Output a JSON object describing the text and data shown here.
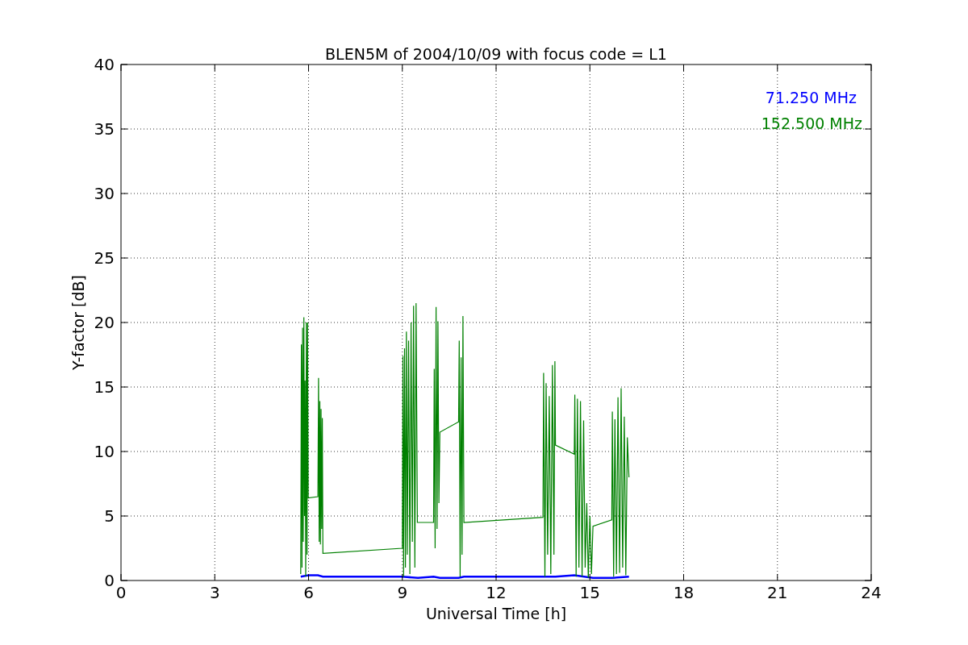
{
  "chart_data": {
    "type": "line",
    "grid": true,
    "title": "BLEN5M of 2004/10/09 with focus code = L1",
    "xlabel": "Universal Time [h]",
    "ylabel": "Y-factor [dB]",
    "xlim": [
      0,
      24
    ],
    "ylim": [
      0,
      40
    ],
    "xticks": [
      0,
      3,
      6,
      9,
      12,
      15,
      18,
      21,
      24
    ],
    "yticks": [
      0,
      5,
      10,
      15,
      20,
      25,
      30,
      35,
      40
    ],
    "series": [
      {
        "name": "71.250 MHz",
        "color": "#0000ff",
        "x": [
          5.75,
          6.0,
          6.3,
          6.46,
          9.0,
          9.5,
          10.0,
          10.2,
          10.8,
          10.97,
          13.5,
          13.9,
          14.5,
          15.1,
          15.7,
          16.25
        ],
        "values": [
          0.3,
          0.4,
          0.4,
          0.3,
          0.3,
          0.2,
          0.3,
          0.2,
          0.2,
          0.3,
          0.3,
          0.3,
          0.4,
          0.2,
          0.2,
          0.3
        ]
      },
      {
        "name": "152.500 MHz",
        "color": "#008000",
        "x": [
          5.75,
          5.77,
          5.79,
          5.81,
          5.83,
          5.85,
          5.87,
          5.89,
          5.91,
          5.93,
          5.95,
          5.97,
          5.99,
          6.3,
          6.32,
          6.34,
          6.36,
          6.38,
          6.4,
          6.42,
          6.44,
          6.46,
          9.0,
          9.02,
          9.04,
          9.07,
          9.1,
          9.13,
          9.16,
          9.2,
          9.24,
          9.28,
          9.32,
          9.36,
          9.4,
          9.44,
          9.48,
          10.0,
          10.02,
          10.05,
          10.08,
          10.11,
          10.14,
          10.17,
          10.2,
          10.8,
          10.82,
          10.85,
          10.88,
          10.91,
          10.94,
          10.97,
          13.5,
          13.52,
          13.56,
          13.6,
          13.65,
          13.7,
          13.75,
          13.8,
          13.85,
          13.88,
          13.9,
          14.5,
          14.52,
          14.56,
          14.6,
          14.65,
          14.7,
          14.75,
          14.8,
          14.85,
          14.9,
          14.95,
          15.0,
          15.05,
          15.1,
          15.7,
          15.72,
          15.76,
          15.8,
          15.85,
          15.9,
          15.95,
          16.0,
          16.05,
          16.1,
          16.15,
          16.2,
          16.25
        ],
        "values": [
          0.5,
          18.3,
          1,
          19.6,
          3,
          20.4,
          5,
          15.5,
          0.3,
          20,
          2,
          20,
          6.4,
          6.5,
          15.7,
          3,
          13.9,
          2.8,
          13.3,
          4,
          12.6,
          2.1,
          2.5,
          17.4,
          0.3,
          18,
          1,
          19.3,
          2,
          18.6,
          0.5,
          20,
          3,
          21.3,
          1,
          21.5,
          4.5,
          4.5,
          16.4,
          2.5,
          21.2,
          4,
          20.1,
          6,
          11.5,
          12.3,
          18.6,
          0.3,
          17.3,
          2,
          20.5,
          4.5,
          4.9,
          16.1,
          0.3,
          15.3,
          2,
          14.3,
          0.5,
          16.7,
          2,
          17,
          10.5,
          9.8,
          14.4,
          0.3,
          14.1,
          1,
          13.9,
          0.3,
          12.4,
          1,
          6,
          0.2,
          5,
          0.5,
          4.2,
          4.7,
          13.1,
          0.3,
          12.5,
          0.5,
          14.2,
          0.6,
          14.9,
          1,
          12.7,
          0.4,
          11.1,
          8
        ]
      }
    ]
  }
}
